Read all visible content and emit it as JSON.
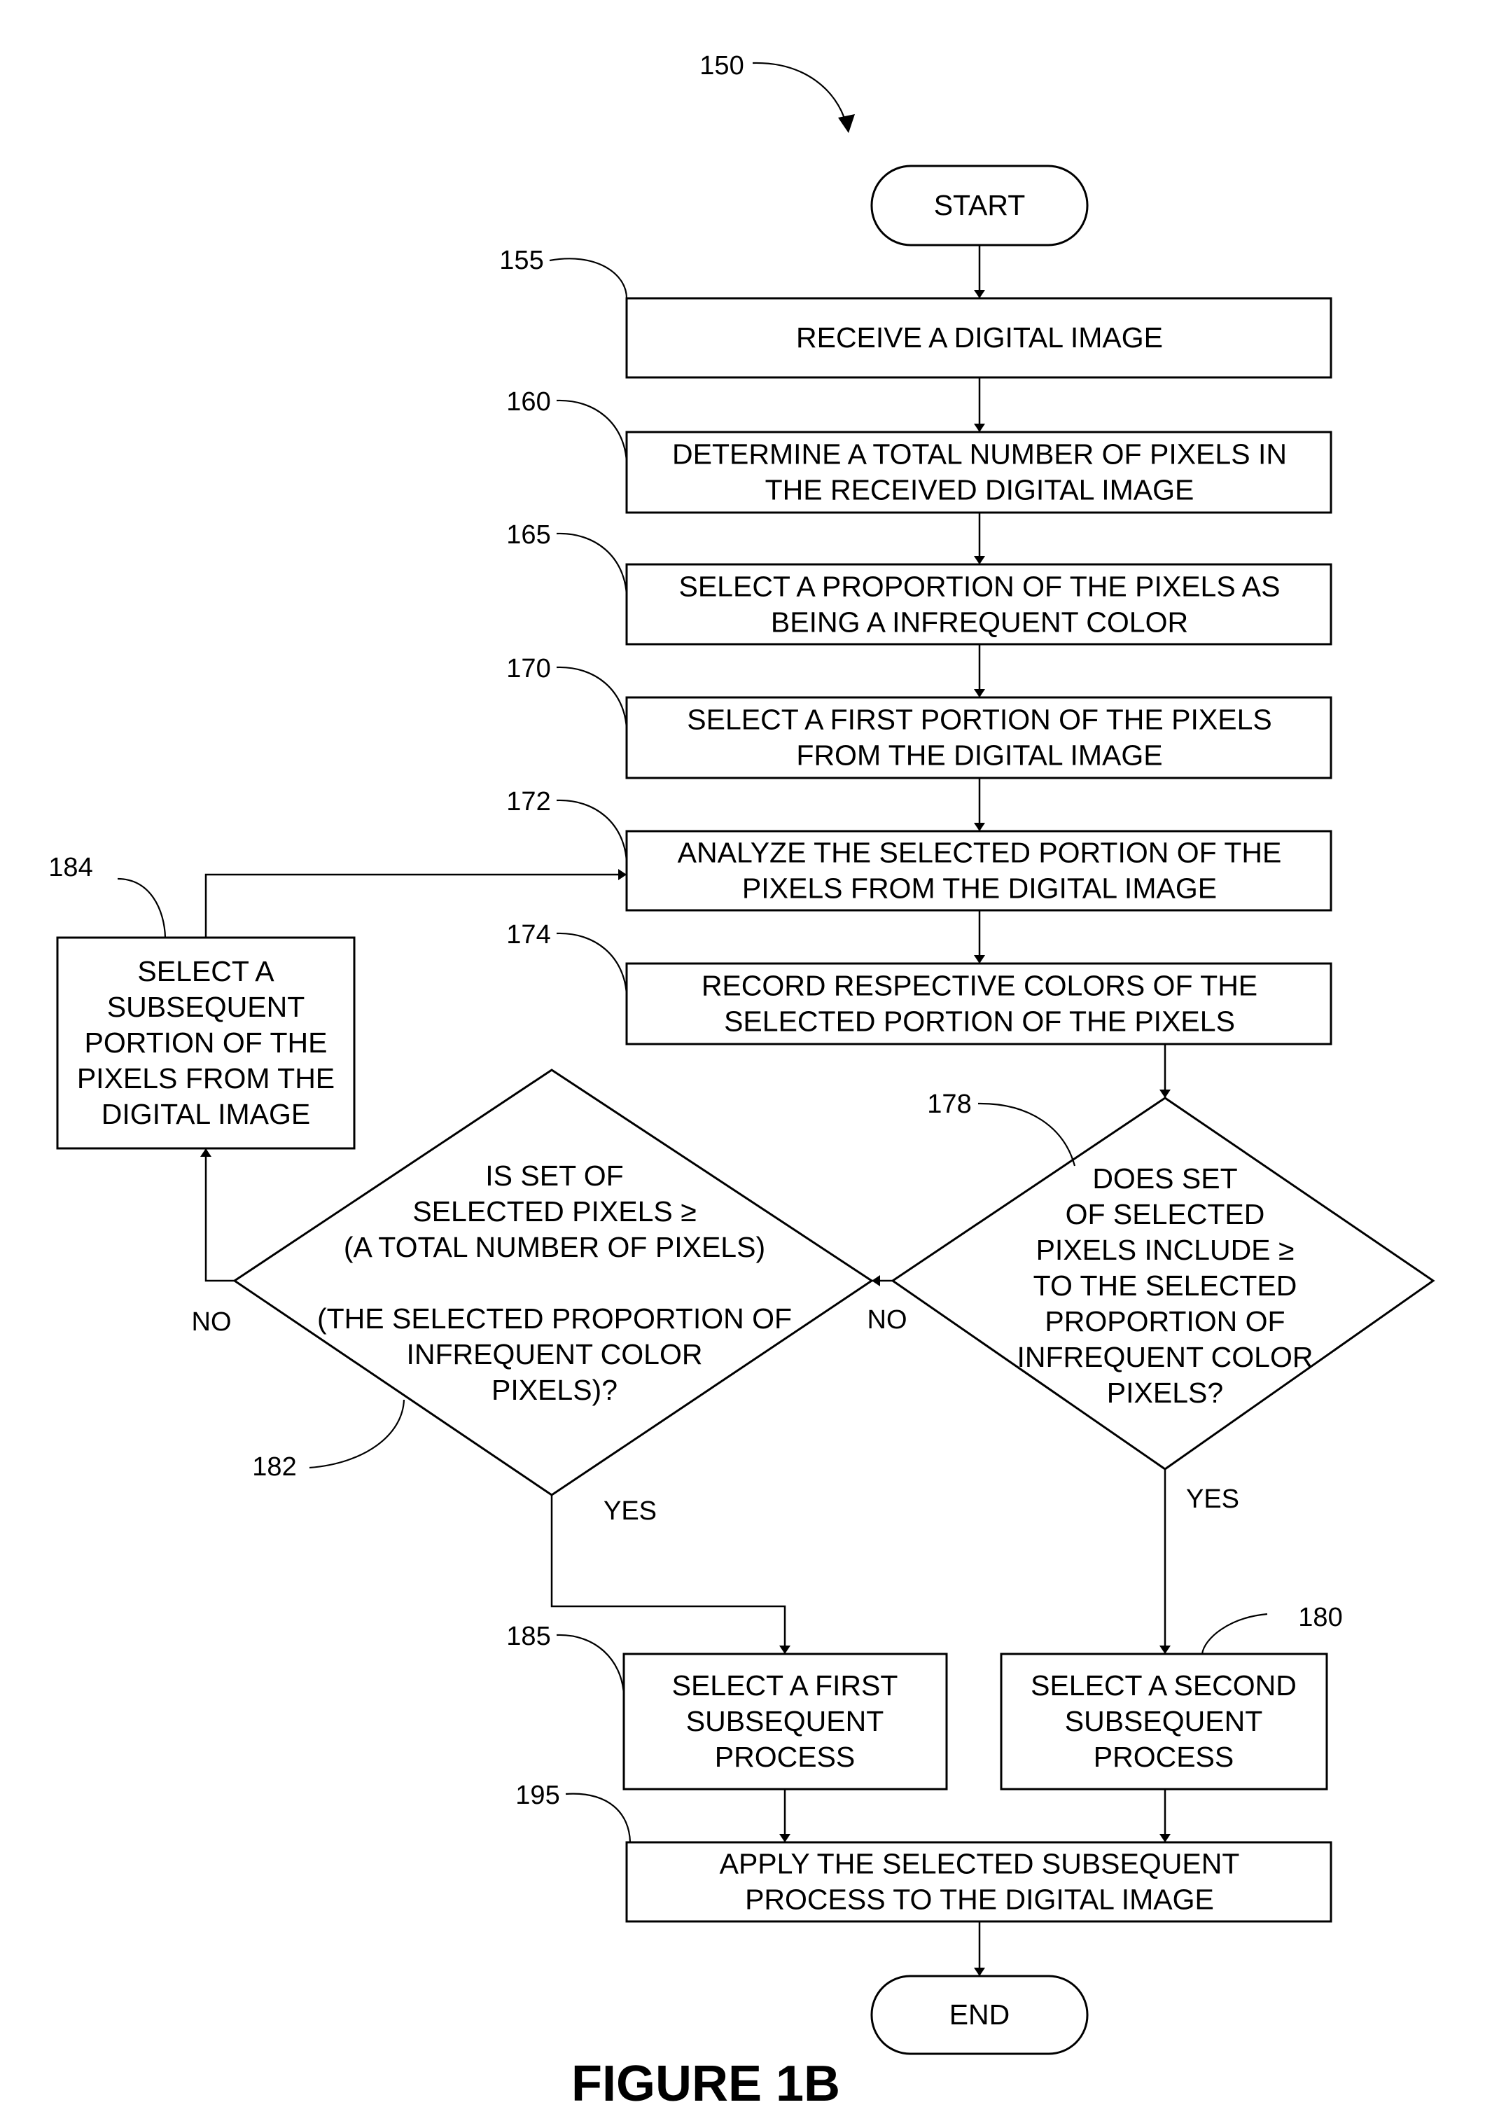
{
  "figure": {
    "title": "FIGURE 1B",
    "reference": "150"
  },
  "nodes": {
    "start": {
      "type": "terminal",
      "lines": [
        "START"
      ]
    },
    "n155": {
      "type": "process",
      "ref": "155",
      "lines": [
        "RECEIVE A DIGITAL IMAGE"
      ]
    },
    "n160": {
      "type": "process",
      "ref": "160",
      "lines": [
        "DETERMINE A TOTAL NUMBER OF PIXELS IN",
        "THE RECEIVED DIGITAL IMAGE"
      ]
    },
    "n165": {
      "type": "process",
      "ref": "165",
      "lines": [
        "SELECT A PROPORTION OF THE PIXELS AS",
        "BEING A INFREQUENT COLOR"
      ]
    },
    "n170": {
      "type": "process",
      "ref": "170",
      "lines": [
        "SELECT A FIRST PORTION OF THE PIXELS",
        "FROM THE DIGITAL IMAGE"
      ]
    },
    "n172": {
      "type": "process",
      "ref": "172",
      "lines": [
        "ANALYZE THE SELECTED PORTION OF THE",
        "PIXELS FROM THE DIGITAL IMAGE"
      ]
    },
    "n174": {
      "type": "process",
      "ref": "174",
      "lines": [
        "RECORD RESPECTIVE COLORS OF THE",
        "SELECTED PORTION OF THE PIXELS"
      ]
    },
    "n178": {
      "type": "decision",
      "ref": "178",
      "lines": [
        "DOES SET",
        "OF SELECTED",
        "PIXELS INCLUDE ≥",
        "TO THE SELECTED",
        "PROPORTION OF",
        "INFREQUENT COLOR",
        "PIXELS?"
      ]
    },
    "n182": {
      "type": "decision",
      "ref": "182",
      "lines": [
        "IS SET OF",
        "SELECTED PIXELS ≥",
        "(A TOTAL NUMBER OF PIXELS)",
        "",
        "(THE SELECTED PROPORTION OF",
        "INFREQUENT COLOR",
        "PIXELS)?"
      ]
    },
    "n184": {
      "type": "process",
      "ref": "184",
      "lines": [
        "SELECT A",
        "SUBSEQUENT",
        "PORTION OF THE",
        "PIXELS FROM THE",
        "DIGITAL IMAGE"
      ]
    },
    "n185": {
      "type": "process",
      "ref": "185",
      "lines": [
        "SELECT A FIRST",
        "SUBSEQUENT",
        "PROCESS"
      ]
    },
    "n180": {
      "type": "process",
      "ref": "180",
      "lines": [
        "SELECT A SECOND",
        "SUBSEQUENT",
        "PROCESS"
      ]
    },
    "n195": {
      "type": "process",
      "ref": "195",
      "lines": [
        "APPLY THE SELECTED SUBSEQUENT",
        "PROCESS TO THE DIGITAL IMAGE"
      ]
    },
    "end": {
      "type": "terminal",
      "lines": [
        "END"
      ]
    }
  },
  "edges": [
    {
      "from": "start",
      "to": "n155"
    },
    {
      "from": "n155",
      "to": "n160"
    },
    {
      "from": "n160",
      "to": "n165"
    },
    {
      "from": "n165",
      "to": "n170"
    },
    {
      "from": "n170",
      "to": "n172"
    },
    {
      "from": "n172",
      "to": "n174"
    },
    {
      "from": "n174",
      "to": "n178"
    },
    {
      "from": "n178",
      "to": "n182",
      "label": "NO"
    },
    {
      "from": "n178",
      "to": "n180",
      "label": "YES"
    },
    {
      "from": "n182",
      "to": "n184",
      "label": "NO"
    },
    {
      "from": "n182",
      "to": "n185",
      "label": "YES"
    },
    {
      "from": "n184",
      "to": "n172"
    },
    {
      "from": "n185",
      "to": "n195"
    },
    {
      "from": "n180",
      "to": "n195"
    },
    {
      "from": "n195",
      "to": "end"
    }
  ],
  "branch_labels": {
    "n178_no": "NO",
    "n178_yes": "YES",
    "n182_no": "NO",
    "n182_yes": "YES"
  }
}
